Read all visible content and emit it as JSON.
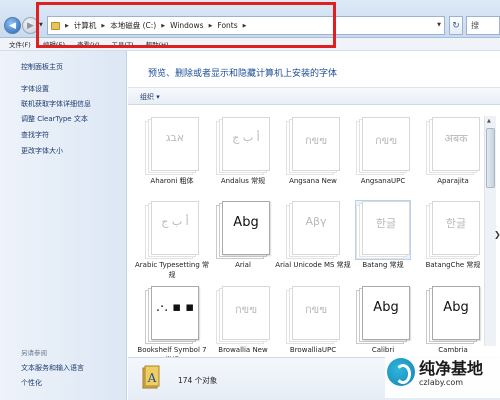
{
  "address": {
    "segments": [
      "计算机",
      "本地磁盘 (C:)",
      "Windows",
      "Fonts"
    ],
    "search_placeholder": "搜"
  },
  "menu": [
    "文件(F)",
    "编辑(E)",
    "查看(V)",
    "工具(T)",
    "帮助(H)"
  ],
  "sidebar": {
    "home": "控制面板主页",
    "links": [
      "字体设置",
      "联机获取字体详细信息",
      "调整 ClearType 文本",
      "查找字符",
      "更改字体大小"
    ],
    "see_also_heading": "另请参阅",
    "see_also": [
      "文本服务和输入语言",
      "个性化"
    ]
  },
  "content": {
    "title": "预览、删除或者显示和隐藏计算机上安装的字体",
    "organize": "组织 ▾"
  },
  "fonts": [
    {
      "label": "Aharoni 粗体",
      "sample": "אבג",
      "faint": true
    },
    {
      "label": "Andalus 常规",
      "sample": "أ ب ج",
      "faint": true
    },
    {
      "label": "Angsana New",
      "sample": "กขฃ",
      "faint": true
    },
    {
      "label": "AngsanaUPC",
      "sample": "กขฃ",
      "faint": true
    },
    {
      "label": "Aparajita",
      "sample": "अबक",
      "faint": true
    },
    {
      "label": "Arabic Typesetting 常规",
      "sample": "أ ب ج",
      "faint": true
    },
    {
      "label": "Arial",
      "sample": "Abg",
      "faint": false
    },
    {
      "label": "Arial Unicode MS 常规",
      "sample": "Αβγ",
      "faint": true
    },
    {
      "label": "Batang 常规",
      "sample": "한글",
      "faint": true,
      "selected": true
    },
    {
      "label": "BatangChe 常规",
      "sample": "한글",
      "faint": true
    },
    {
      "label": "Bookshelf Symbol 7 常规",
      "sample": ".·. ▪ ▪",
      "faint": false
    },
    {
      "label": "Browallia New",
      "sample": "กขฃ",
      "faint": true
    },
    {
      "label": "BrowalliaUPC",
      "sample": "กขฃ",
      "faint": true
    },
    {
      "label": "Calibri",
      "sample": "Abg",
      "faint": false
    },
    {
      "label": "Cambria",
      "sample": "Abg",
      "faint": false
    }
  ],
  "status": {
    "count": "174 个对象"
  },
  "watermark": {
    "title": "纯净基地",
    "url": "czlaby.com"
  }
}
